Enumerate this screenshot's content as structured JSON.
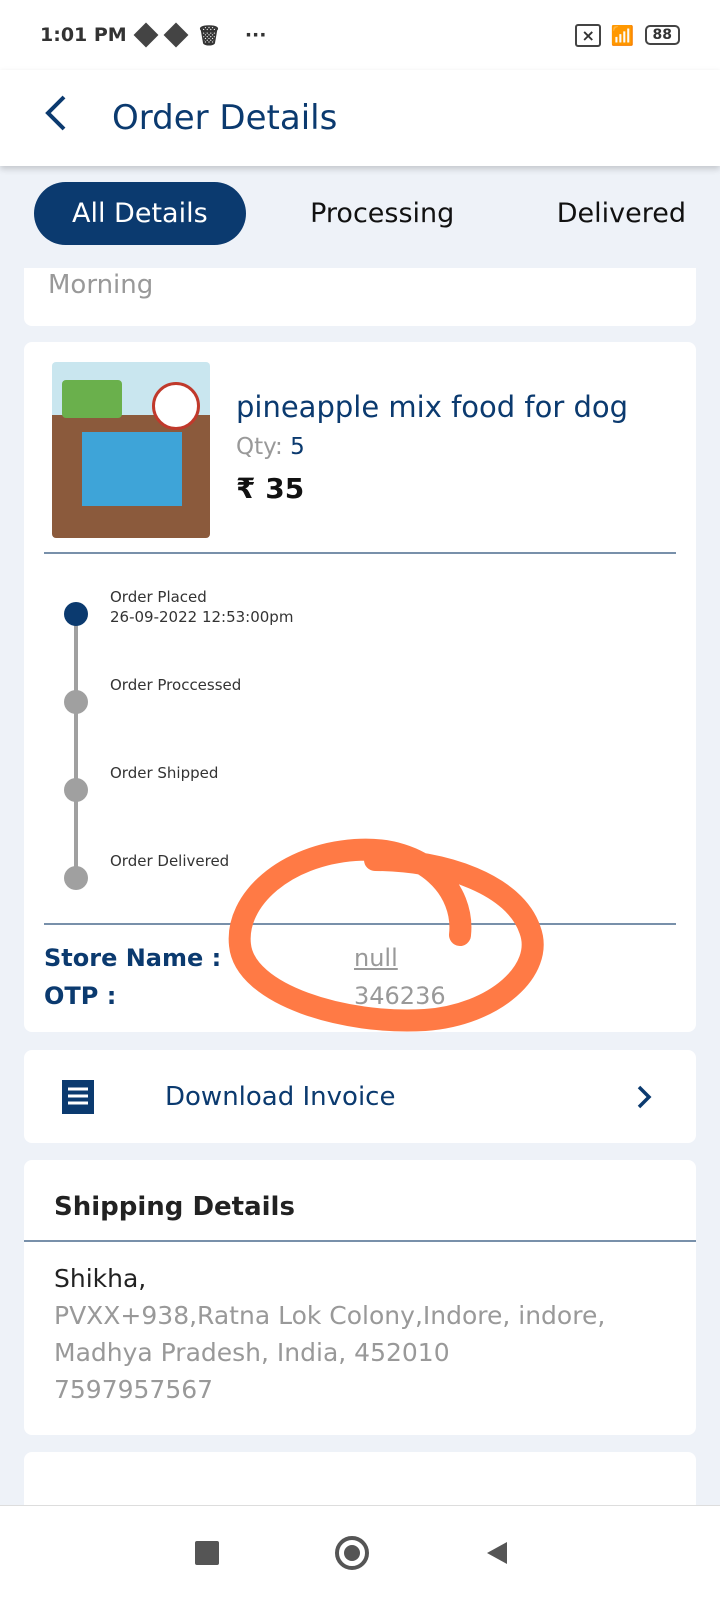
{
  "status_bar": {
    "time": "1:01 PM",
    "battery": "88",
    "icons": [
      "download-icon",
      "download-icon",
      "trash-icon",
      "more-icon",
      "no-sim-icon",
      "wifi-icon",
      "battery-icon"
    ]
  },
  "header": {
    "title": "Order Details",
    "back_icon": "chevron-left-icon"
  },
  "tabs": [
    {
      "label": "All Details",
      "active": true
    },
    {
      "label": "Processing",
      "active": false
    },
    {
      "label": "Delivered",
      "active": false
    }
  ],
  "prev_card": {
    "text": "Morning"
  },
  "product": {
    "name": "pineapple mix food for dog",
    "qty_label": "Qty:",
    "qty": "5",
    "price": "₹ 35"
  },
  "timeline": [
    {
      "label": "Order Placed",
      "date": "26-09-2022 12:53:00pm",
      "done": true
    },
    {
      "label": "Order Proccessed",
      "done": false
    },
    {
      "label": "Order Shipped",
      "done": false
    },
    {
      "label": "Order Delivered",
      "done": false
    }
  ],
  "store": {
    "store_label": "Store Name :",
    "store_value": "null",
    "otp_label": "OTP :",
    "otp_value": "346236"
  },
  "invoice": {
    "label": "Download Invoice",
    "icon": "receipt-icon"
  },
  "shipping": {
    "title": "Shipping Details",
    "name": "Shikha,",
    "address1": "PVXX+938,Ratna Lok Colony,Indore, indore,",
    "address2": "Madhya Pradesh, India, 452010",
    "phone": "7597957567"
  },
  "colors": {
    "primary": "#0b3a6f",
    "annotation": "#ff7a45"
  }
}
